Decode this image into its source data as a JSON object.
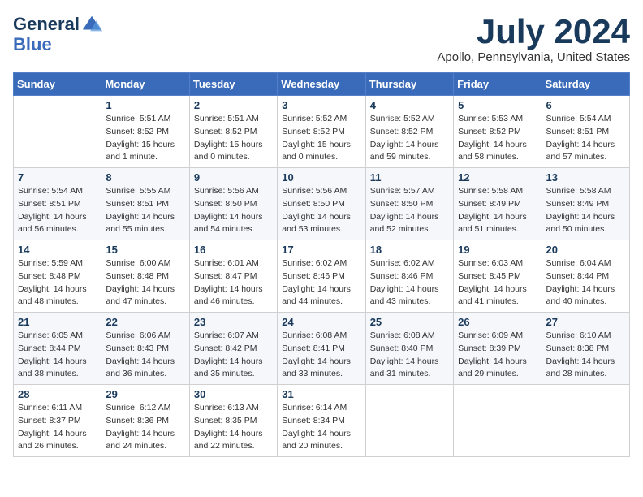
{
  "header": {
    "logo_line1": "General",
    "logo_line2": "Blue",
    "month": "July 2024",
    "location": "Apollo, Pennsylvania, United States"
  },
  "days_of_week": [
    "Sunday",
    "Monday",
    "Tuesday",
    "Wednesday",
    "Thursday",
    "Friday",
    "Saturday"
  ],
  "weeks": [
    [
      {
        "day": "",
        "sunrise": "",
        "sunset": "",
        "daylight": ""
      },
      {
        "day": "1",
        "sunrise": "Sunrise: 5:51 AM",
        "sunset": "Sunset: 8:52 PM",
        "daylight": "Daylight: 15 hours and 1 minute."
      },
      {
        "day": "2",
        "sunrise": "Sunrise: 5:51 AM",
        "sunset": "Sunset: 8:52 PM",
        "daylight": "Daylight: 15 hours and 0 minutes."
      },
      {
        "day": "3",
        "sunrise": "Sunrise: 5:52 AM",
        "sunset": "Sunset: 8:52 PM",
        "daylight": "Daylight: 15 hours and 0 minutes."
      },
      {
        "day": "4",
        "sunrise": "Sunrise: 5:52 AM",
        "sunset": "Sunset: 8:52 PM",
        "daylight": "Daylight: 14 hours and 59 minutes."
      },
      {
        "day": "5",
        "sunrise": "Sunrise: 5:53 AM",
        "sunset": "Sunset: 8:52 PM",
        "daylight": "Daylight: 14 hours and 58 minutes."
      },
      {
        "day": "6",
        "sunrise": "Sunrise: 5:54 AM",
        "sunset": "Sunset: 8:51 PM",
        "daylight": "Daylight: 14 hours and 57 minutes."
      }
    ],
    [
      {
        "day": "7",
        "sunrise": "Sunrise: 5:54 AM",
        "sunset": "Sunset: 8:51 PM",
        "daylight": "Daylight: 14 hours and 56 minutes."
      },
      {
        "day": "8",
        "sunrise": "Sunrise: 5:55 AM",
        "sunset": "Sunset: 8:51 PM",
        "daylight": "Daylight: 14 hours and 55 minutes."
      },
      {
        "day": "9",
        "sunrise": "Sunrise: 5:56 AM",
        "sunset": "Sunset: 8:50 PM",
        "daylight": "Daylight: 14 hours and 54 minutes."
      },
      {
        "day": "10",
        "sunrise": "Sunrise: 5:56 AM",
        "sunset": "Sunset: 8:50 PM",
        "daylight": "Daylight: 14 hours and 53 minutes."
      },
      {
        "day": "11",
        "sunrise": "Sunrise: 5:57 AM",
        "sunset": "Sunset: 8:50 PM",
        "daylight": "Daylight: 14 hours and 52 minutes."
      },
      {
        "day": "12",
        "sunrise": "Sunrise: 5:58 AM",
        "sunset": "Sunset: 8:49 PM",
        "daylight": "Daylight: 14 hours and 51 minutes."
      },
      {
        "day": "13",
        "sunrise": "Sunrise: 5:58 AM",
        "sunset": "Sunset: 8:49 PM",
        "daylight": "Daylight: 14 hours and 50 minutes."
      }
    ],
    [
      {
        "day": "14",
        "sunrise": "Sunrise: 5:59 AM",
        "sunset": "Sunset: 8:48 PM",
        "daylight": "Daylight: 14 hours and 48 minutes."
      },
      {
        "day": "15",
        "sunrise": "Sunrise: 6:00 AM",
        "sunset": "Sunset: 8:48 PM",
        "daylight": "Daylight: 14 hours and 47 minutes."
      },
      {
        "day": "16",
        "sunrise": "Sunrise: 6:01 AM",
        "sunset": "Sunset: 8:47 PM",
        "daylight": "Daylight: 14 hours and 46 minutes."
      },
      {
        "day": "17",
        "sunrise": "Sunrise: 6:02 AM",
        "sunset": "Sunset: 8:46 PM",
        "daylight": "Daylight: 14 hours and 44 minutes."
      },
      {
        "day": "18",
        "sunrise": "Sunrise: 6:02 AM",
        "sunset": "Sunset: 8:46 PM",
        "daylight": "Daylight: 14 hours and 43 minutes."
      },
      {
        "day": "19",
        "sunrise": "Sunrise: 6:03 AM",
        "sunset": "Sunset: 8:45 PM",
        "daylight": "Daylight: 14 hours and 41 minutes."
      },
      {
        "day": "20",
        "sunrise": "Sunrise: 6:04 AM",
        "sunset": "Sunset: 8:44 PM",
        "daylight": "Daylight: 14 hours and 40 minutes."
      }
    ],
    [
      {
        "day": "21",
        "sunrise": "Sunrise: 6:05 AM",
        "sunset": "Sunset: 8:44 PM",
        "daylight": "Daylight: 14 hours and 38 minutes."
      },
      {
        "day": "22",
        "sunrise": "Sunrise: 6:06 AM",
        "sunset": "Sunset: 8:43 PM",
        "daylight": "Daylight: 14 hours and 36 minutes."
      },
      {
        "day": "23",
        "sunrise": "Sunrise: 6:07 AM",
        "sunset": "Sunset: 8:42 PM",
        "daylight": "Daylight: 14 hours and 35 minutes."
      },
      {
        "day": "24",
        "sunrise": "Sunrise: 6:08 AM",
        "sunset": "Sunset: 8:41 PM",
        "daylight": "Daylight: 14 hours and 33 minutes."
      },
      {
        "day": "25",
        "sunrise": "Sunrise: 6:08 AM",
        "sunset": "Sunset: 8:40 PM",
        "daylight": "Daylight: 14 hours and 31 minutes."
      },
      {
        "day": "26",
        "sunrise": "Sunrise: 6:09 AM",
        "sunset": "Sunset: 8:39 PM",
        "daylight": "Daylight: 14 hours and 29 minutes."
      },
      {
        "day": "27",
        "sunrise": "Sunrise: 6:10 AM",
        "sunset": "Sunset: 8:38 PM",
        "daylight": "Daylight: 14 hours and 28 minutes."
      }
    ],
    [
      {
        "day": "28",
        "sunrise": "Sunrise: 6:11 AM",
        "sunset": "Sunset: 8:37 PM",
        "daylight": "Daylight: 14 hours and 26 minutes."
      },
      {
        "day": "29",
        "sunrise": "Sunrise: 6:12 AM",
        "sunset": "Sunset: 8:36 PM",
        "daylight": "Daylight: 14 hours and 24 minutes."
      },
      {
        "day": "30",
        "sunrise": "Sunrise: 6:13 AM",
        "sunset": "Sunset: 8:35 PM",
        "daylight": "Daylight: 14 hours and 22 minutes."
      },
      {
        "day": "31",
        "sunrise": "Sunrise: 6:14 AM",
        "sunset": "Sunset: 8:34 PM",
        "daylight": "Daylight: 14 hours and 20 minutes."
      },
      {
        "day": "",
        "sunrise": "",
        "sunset": "",
        "daylight": ""
      },
      {
        "day": "",
        "sunrise": "",
        "sunset": "",
        "daylight": ""
      },
      {
        "day": "",
        "sunrise": "",
        "sunset": "",
        "daylight": ""
      }
    ]
  ]
}
